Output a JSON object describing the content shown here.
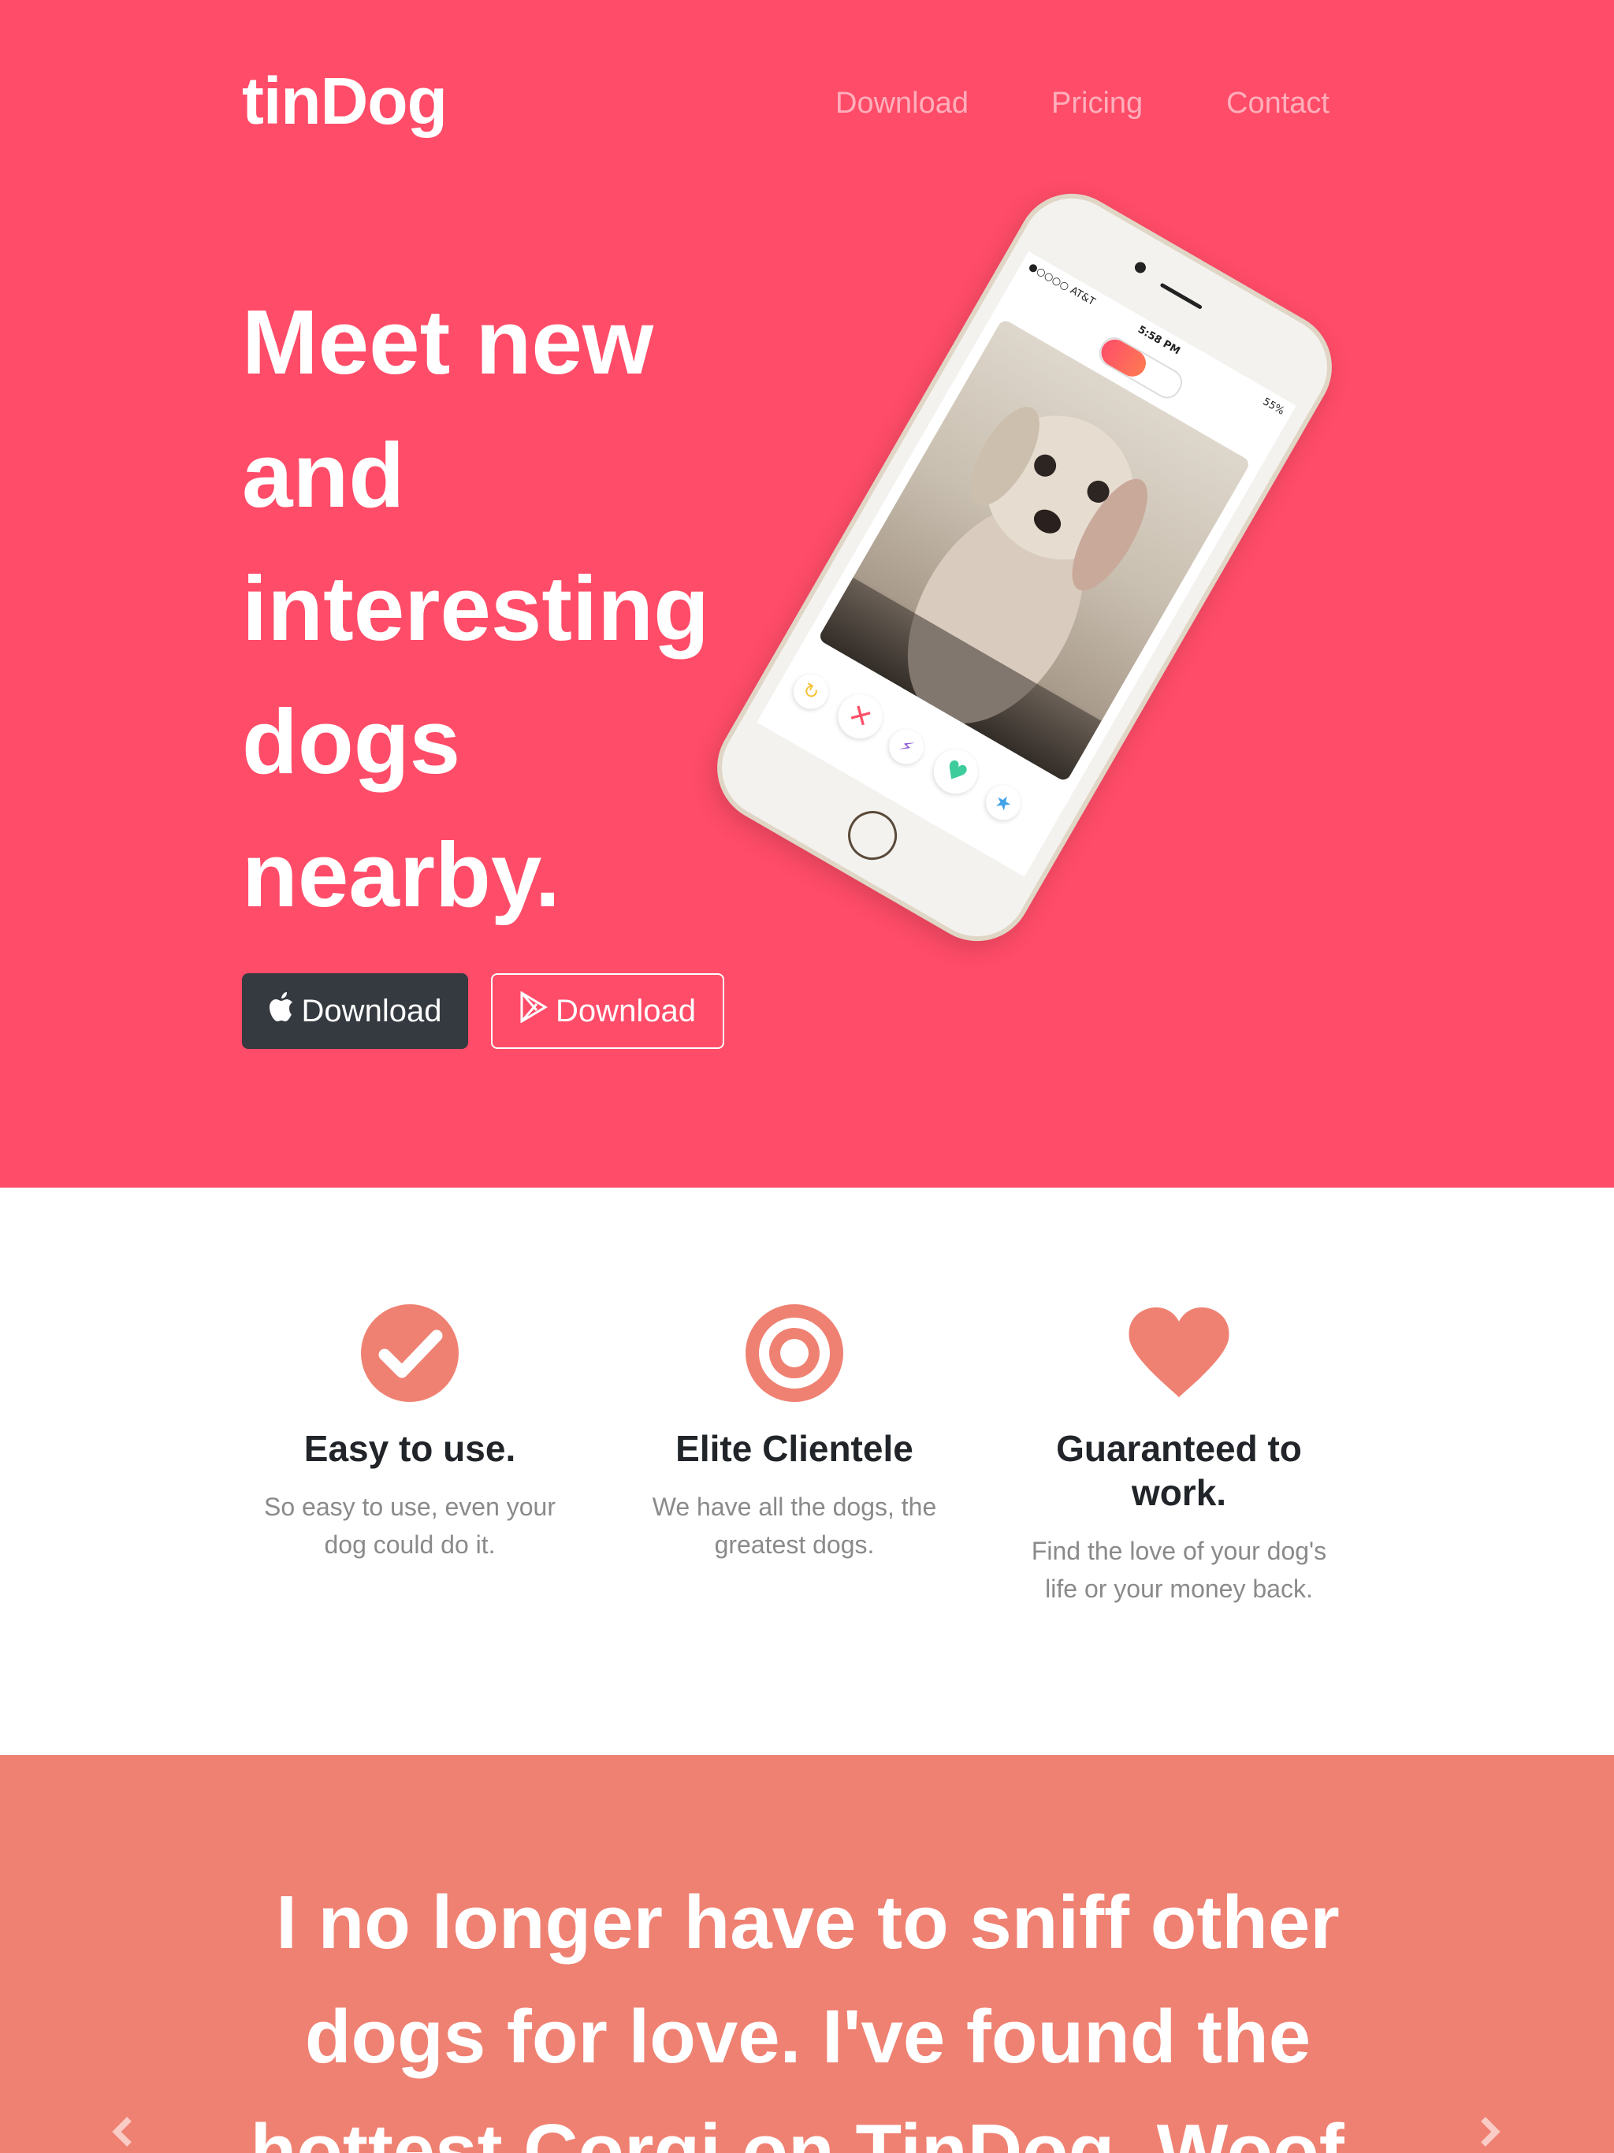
{
  "header": {
    "brand": "tinDog",
    "nav": {
      "download": "Download",
      "pricing": "Pricing",
      "contact": "Contact"
    }
  },
  "hero": {
    "headline": "Meet new and interesting dogs nearby.",
    "apple_button_label": "Download",
    "google_button_label": "Download",
    "phone": {
      "carrier": "●○○○○ AT&T",
      "time": "5:58 PM",
      "battery": "55%"
    }
  },
  "features": [
    {
      "title": "Easy to use.",
      "text": "So easy to use, even your dog could do it.",
      "icon": "check-circle-icon"
    },
    {
      "title": "Elite Clientele",
      "text": "We have all the dogs, the greatest dogs.",
      "icon": "bullseye-icon"
    },
    {
      "title": "Guaranteed to work.",
      "text": "Find the love of your dog's life or your money back.",
      "icon": "heart-icon"
    }
  ],
  "testimonial": {
    "quote": "I no longer have to sniff other dogs for love. I've found the hottest Corgi on TinDog. Woof."
  },
  "colors": {
    "hero_bg": "#ff4c68",
    "feature_icon": "#ef8172",
    "testimonial_bg": "#ef8172",
    "dark_button": "#343a40"
  }
}
